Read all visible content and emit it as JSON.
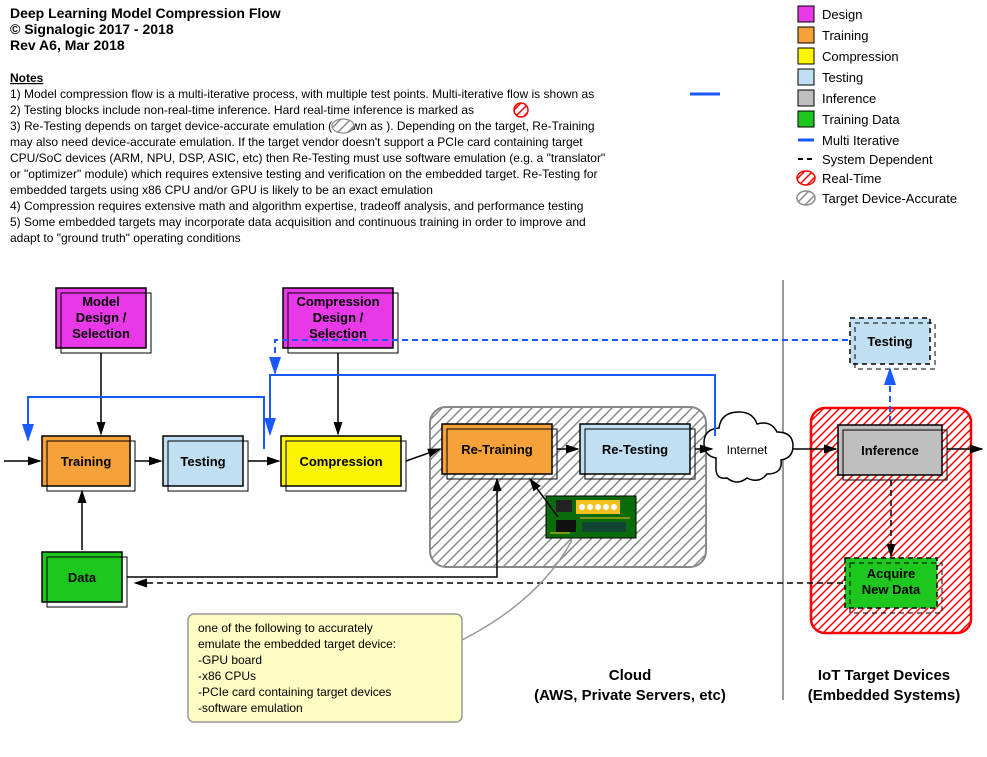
{
  "header": {
    "title": "Deep Learning Model Compression Flow",
    "copyright": "© Signalogic 2017 - 2018",
    "rev": "Rev A6, Mar 2018"
  },
  "notes_heading": "Notes",
  "notes": [
    "1) Model compression flow is a multi-iterative process, with multiple test points.  Multi-iterative flow is shown as",
    "2) Testing blocks include non-real-time inference.  Hard real-time inference is marked as",
    "3) Re-Testing depends on target device-accurate emulation (shown as        ).  Depending on the target, Re-Training",
    "    may also need device-accurate emulation.  If the target vendor doesn't support a PCIe card containing target",
    "    CPU/SoC devices (ARM, NPU, DSP, ASIC, etc) then Re-Testing must use software emulation (e.g. a \"translator\"",
    "    or \"optimizer\" module) which requires extensive testing and verification on the embedded target.  Re-Testing for",
    "    embedded targets using x86 CPU and/or GPU is likely to be an exact emulation",
    "4) Compression requires extensive math and algorithm expertise, tradeoff analysis, and performance testing",
    "5) Some embedded targets may incorporate data acquisition and continuous training in order to improve and",
    "    adapt to \"ground truth\" operating conditions"
  ],
  "legend": [
    {
      "label": "Design",
      "type": "box",
      "fill": "#e838e8",
      "stroke": "#000"
    },
    {
      "label": "Training",
      "type": "box",
      "fill": "#f7a13a",
      "stroke": "#000"
    },
    {
      "label": "Compression",
      "type": "box",
      "fill": "#fcf403",
      "stroke": "#000"
    },
    {
      "label": "Testing",
      "type": "box",
      "fill": "#c1dff2",
      "stroke": "#000"
    },
    {
      "label": "Inference",
      "type": "box",
      "fill": "#bfbfbf",
      "stroke": "#000"
    },
    {
      "label": "Training Data",
      "type": "box",
      "fill": "#1ec71e",
      "stroke": "#000"
    },
    {
      "label": "Multi Iterative",
      "type": "line",
      "stroke": "#1a59ff",
      "width": 2
    },
    {
      "label": "System Dependent",
      "type": "line",
      "stroke": "#000",
      "dash": "6,4",
      "width": 2
    },
    {
      "label": "Real-Time",
      "type": "hatch",
      "stroke": "#ff0000"
    },
    {
      "label": "Target Device-Accurate",
      "type": "hatch",
      "stroke": "#888"
    }
  ],
  "blocks": {
    "model_design": {
      "l1": "Model",
      "l2": "Design /",
      "l3": "Selection"
    },
    "comp_design": {
      "l1": "Compression",
      "l2": "Design /",
      "l3": "Selection"
    },
    "training": {
      "label": "Training"
    },
    "testing1": {
      "label": "Testing"
    },
    "compression": {
      "label": "Compression"
    },
    "retraining": {
      "label": "Re-Training"
    },
    "retesting": {
      "label": "Re-Testing"
    },
    "internet": {
      "label": "Internet"
    },
    "testing2": {
      "label": "Testing"
    },
    "inference": {
      "label": "Inference"
    },
    "acquire": {
      "l1": "Acquire",
      "l2": "New Data"
    },
    "data": {
      "label": "Data"
    }
  },
  "callout": {
    "l1": "one of the following to accurately",
    "l2": "emulate the embedded target device:",
    "l3": "  -GPU board",
    "l4": "  -x86 CPUs",
    "l5": "  -PCIe card containing target devices",
    "l6": "  -software emulation"
  },
  "regions": {
    "cloud_l1": "Cloud",
    "cloud_l2": "(AWS, Private Servers, etc)",
    "iot_l1": "IoT Target Devices",
    "iot_l2": "(Embedded Systems)"
  },
  "colors": {
    "design": "#e838e8",
    "training": "#f7a13a",
    "compression": "#fcf403",
    "testing": "#c1dff2",
    "inference": "#bfbfbf",
    "tdata": "#1ec71e",
    "multi": "#1a59ff",
    "realtime": "#ff0000",
    "accurate": "#888",
    "callout_fill": "#fdfdc4",
    "callout_stroke": "#999",
    "pcb": "#0a6b0a",
    "pcb_gold": "#f5c020"
  }
}
